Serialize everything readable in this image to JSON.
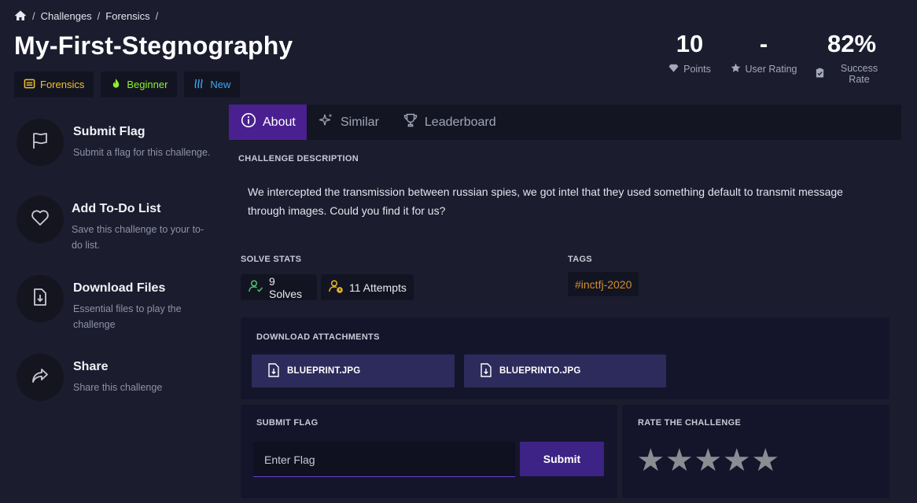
{
  "breadcrumb": {
    "home_icon": "home-icon",
    "items": [
      "Challenges",
      "Forensics"
    ],
    "separator": "/"
  },
  "title": "My-First-Stegnography",
  "badges": [
    {
      "label": "Forensics",
      "icon": "folder-icon",
      "color": "#f2c12e"
    },
    {
      "label": "Beginner",
      "icon": "flame-icon",
      "color": "#8ef22e"
    },
    {
      "label": "New",
      "icon": "waves-icon",
      "color": "#3aa8f0"
    }
  ],
  "stats": [
    {
      "value": "10",
      "label": "Points",
      "icon": "diamond-icon"
    },
    {
      "value": "-",
      "label": "User Rating",
      "icon": "star-icon"
    },
    {
      "value": "82%",
      "label": "Success Rate",
      "icon": "clipboard-check-icon"
    }
  ],
  "sidebar": [
    {
      "title": "Submit Flag",
      "subtitle": "Submit a flag for this challenge.",
      "icon": "flag-icon"
    },
    {
      "title": "Add To-Do List",
      "subtitle": "Save this challenge to your to-do list.",
      "icon": "heart-icon"
    },
    {
      "title": "Download Files",
      "subtitle": "Essential files to play the challenge",
      "icon": "file-download-icon"
    },
    {
      "title": "Share",
      "subtitle": "Share this challenge",
      "icon": "share-icon"
    }
  ],
  "tabs": [
    {
      "label": "About",
      "icon": "info-icon",
      "active": true
    },
    {
      "label": "Similar",
      "icon": "sparkles-icon",
      "active": false
    },
    {
      "label": "Leaderboard",
      "icon": "trophy-icon",
      "active": false
    }
  ],
  "description": {
    "heading": "CHALLENGE DESCRIPTION",
    "text": "We intercepted the transmission between russian spies, we got intel that they used something default to transmit message through images. Could you find it for us?"
  },
  "solve_stats": {
    "heading": "SOLVE STATS",
    "solves": "9 Solves",
    "attempts": "11 Attempts"
  },
  "tags": {
    "heading": "TAGS",
    "items": [
      "#inctfj-2020"
    ]
  },
  "attachments": {
    "heading": "DOWNLOAD ATTACHMENTS",
    "files": [
      "BLUEPRINT.JPG",
      "BLUEPRINTO.JPG"
    ]
  },
  "submit_flag": {
    "heading": "SUBMIT FLAG",
    "placeholder": "Enter Flag",
    "button": "Submit"
  },
  "rate": {
    "heading": "RATE THE CHALLENGE",
    "stars": 5,
    "filled": 0,
    "star_glyph": "★"
  },
  "colors": {
    "accent": "#4a2091",
    "background": "#1b1c2e",
    "panel": "#14152a"
  }
}
